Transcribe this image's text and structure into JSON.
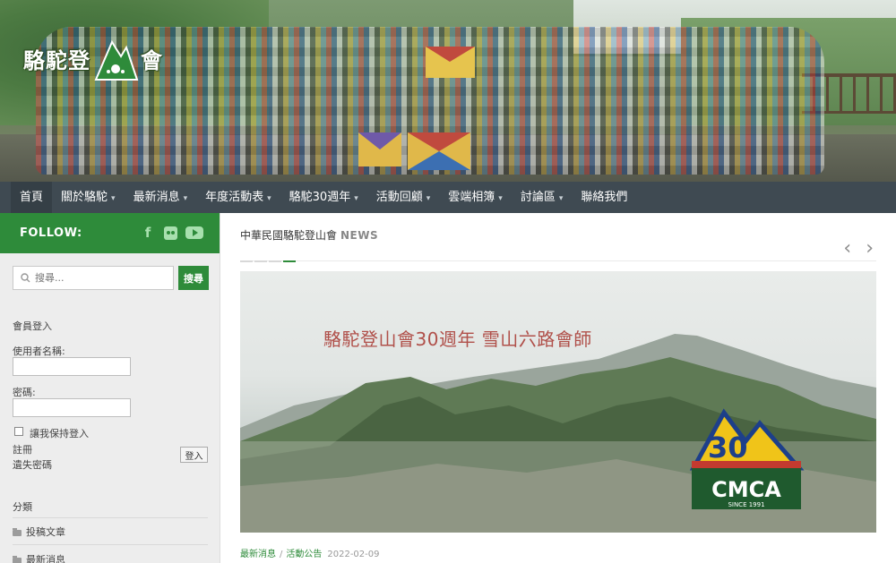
{
  "site": {
    "logo_text_left": "駱駝登",
    "logo_text_right": "會",
    "logo_mark_alt": "camel-mountain-logo"
  },
  "nav": {
    "items": [
      {
        "label": "首頁",
        "has_caret": false,
        "active": true
      },
      {
        "label": "關於駱駝",
        "has_caret": true
      },
      {
        "label": "最新消息",
        "has_caret": true
      },
      {
        "label": "年度活動表",
        "has_caret": true
      },
      {
        "label": "駱駝30週年",
        "has_caret": true
      },
      {
        "label": "活動回顧",
        "has_caret": true
      },
      {
        "label": "雲端相簿",
        "has_caret": true
      },
      {
        "label": "討論區",
        "has_caret": true
      },
      {
        "label": "聯絡我們",
        "has_caret": false
      }
    ]
  },
  "sidebar": {
    "follow_label": "FOLLOW:",
    "social_icons": [
      "facebook-icon",
      "flickr-icon",
      "youtube-icon"
    ],
    "search": {
      "placeholder": "搜尋...",
      "button_label": "搜尋"
    },
    "login": {
      "heading": "會員登入",
      "username_label": "使用者名稱:",
      "password_label": "密碼:",
      "remember_label": "讓我保持登入",
      "register_link": "註冊",
      "forgot_link": "遺失密碼",
      "login_button": "登入"
    },
    "categories": {
      "heading": "分類",
      "items": [
        "投稿文章",
        "最新消息"
      ]
    }
  },
  "main": {
    "section_title": "中華民國駱駝登山會",
    "section_title_suffix": "NEWS",
    "prev_arrow": "‹",
    "next_arrow": "›",
    "slide": {
      "title": "駱駝登山會30週年 雪山六路會師",
      "badge_number": "30",
      "badge_text": "CMCA",
      "badge_since": "SINCE 1991"
    },
    "meta": {
      "category1": "最新消息",
      "separator": "/",
      "category2": "活動公告",
      "date": "2022-02-09"
    }
  },
  "colors": {
    "brand_green": "#2e8b3a",
    "nav_bg": "#3f4a52",
    "slide_title": "#b0504a"
  }
}
